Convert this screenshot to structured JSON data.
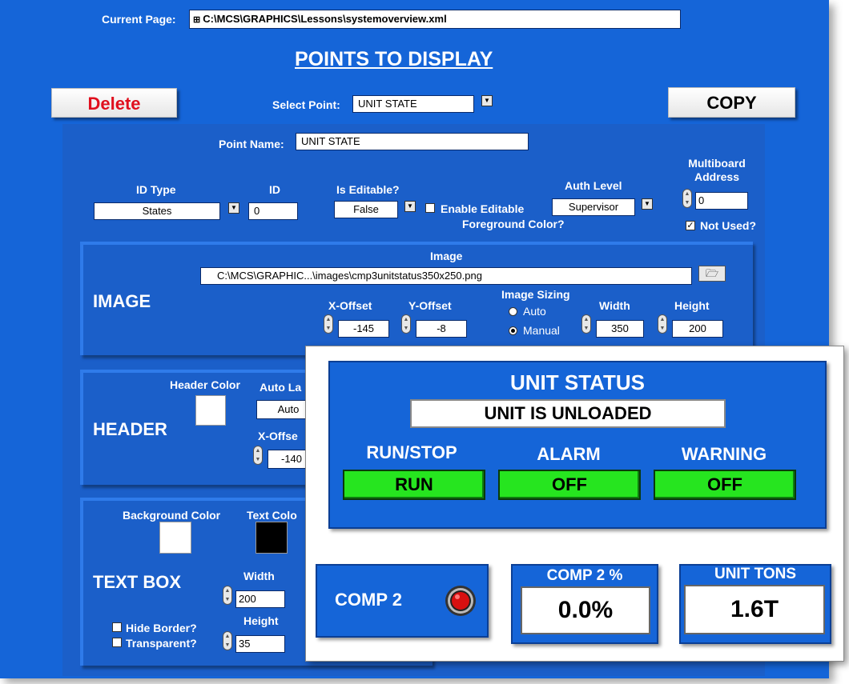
{
  "current_page": {
    "label": "Current Page:",
    "value": "C:\\MCS\\GRAPHICS\\Lessons\\systemoverview.xml"
  },
  "title": "POINTS TO DISPLAY",
  "buttons": {
    "delete": "Delete",
    "copy": "COPY"
  },
  "select_point": {
    "label": "Select Point:",
    "value": "UNIT STATE"
  },
  "point_name": {
    "label": "Point Name:",
    "value": "UNIT STATE"
  },
  "id_type": {
    "label": "ID Type",
    "value": "States"
  },
  "id": {
    "label": "ID",
    "value": "0"
  },
  "is_editable": {
    "label": "Is Editable?",
    "value": "False"
  },
  "enable_editable": {
    "line1": "Enable Editable",
    "line2": "Foreground Color?",
    "checked": false
  },
  "auth_level": {
    "label": "Auth Level",
    "value": "Supervisor"
  },
  "multiboard": {
    "line1": "Multiboard",
    "line2": "Address",
    "value": "0",
    "not_used_label": "Not Used?",
    "not_used_checked": true
  },
  "image_section": {
    "title": "IMAGE",
    "image_label": "Image",
    "path": "C:\\MCS\\GRAPHIC...\\images\\cmp3unitstatus350x250.png",
    "x_offset": {
      "label": "X-Offset",
      "value": "-145"
    },
    "y_offset": {
      "label": "Y-Offset",
      "value": "-8"
    },
    "sizing": {
      "label": "Image Sizing",
      "auto": "Auto",
      "manual": "Manual",
      "selected": "Manual"
    },
    "width": {
      "label": "Width",
      "value": "350"
    },
    "height": {
      "label": "Height",
      "value": "200"
    }
  },
  "header_section": {
    "title": "HEADER",
    "header_color_label": "Header Color",
    "header_color": "#ffffff",
    "auto_label": "Auto La",
    "auto_value": "Auto",
    "x_offset_label": "X-Offse",
    "x_offset_value": "-140"
  },
  "textbox_section": {
    "title": "TEXT BOX",
    "bg_color_label": "Background Color",
    "bg_color": "#ffffff",
    "text_color_label": "Text Colo",
    "text_color": "#000000",
    "width_label": "Width",
    "width_value": "200",
    "height_label": "Height",
    "height_value": "35",
    "hide_border": "Hide Border?",
    "transparent": "Transparent?"
  },
  "preview": {
    "unit_status_title": "UNIT STATUS",
    "unit_status_value": "UNIT IS UNLOADED",
    "indicators": [
      {
        "label": "RUN/STOP",
        "value": "RUN"
      },
      {
        "label": "ALARM",
        "value": "OFF"
      },
      {
        "label": "WARNING",
        "value": "OFF"
      }
    ],
    "comp2_label": "COMP 2",
    "comp2_pct_label": "COMP 2 %",
    "comp2_pct_value": "0.0%",
    "unit_tons_label": "UNIT TONS",
    "unit_tons_value": "1.6T",
    "indicator_on_color": "#26e51f",
    "led_color": "#d81010"
  }
}
